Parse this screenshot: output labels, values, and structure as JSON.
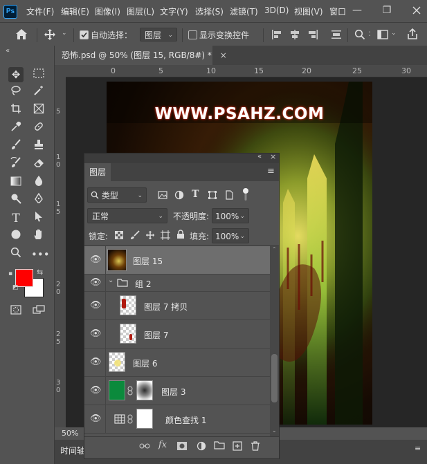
{
  "menu": [
    "文件(F)",
    "编辑(E)",
    "图像(I)",
    "图层(L)",
    "文字(Y)",
    "选择(S)",
    "滤镜(T)",
    "3D(D)",
    "视图(V)",
    "窗口"
  ],
  "app_logo": "Ps",
  "window": {
    "minimize": "—",
    "maximize": "❐"
  },
  "options": {
    "auto_select_label": "自动选择：",
    "auto_select_value": "图层",
    "show_transform_label": "显示变换控件"
  },
  "doc_tab": {
    "title": "恐怖.psd @ 50% (图层 15, RGB/8#) *",
    "close": "×"
  },
  "ruler_h": [
    "0",
    "5",
    "10",
    "15",
    "20",
    "25",
    "30"
  ],
  "ruler_v": [
    "5",
    "1 0",
    "1 5",
    "2 0",
    "2 5",
    "3 0"
  ],
  "watermark": "WWW.PSAHZ.COM",
  "status": {
    "zoom": "50%"
  },
  "timeline": {
    "label": "时间轴"
  },
  "layers_panel": {
    "tab_label": "图层",
    "filter_type": "类型",
    "blend_mode": "正常",
    "opacity_label": "不透明度:",
    "opacity_value": "100%",
    "lock_label": "锁定:",
    "fill_label": "填充:",
    "fill_value": "100%",
    "layers": [
      {
        "name": "图层 15"
      },
      {
        "name": "组 2"
      },
      {
        "name": "图层 7 拷贝"
      },
      {
        "name": "图层 7"
      },
      {
        "name": "图层 6"
      },
      {
        "name": "图层 3"
      },
      {
        "name": "颜色查找 1"
      }
    ]
  },
  "colors": {
    "foreground": "#ff0000",
    "background": "#ffffff",
    "layer3_fill": "#0b8a3c"
  }
}
